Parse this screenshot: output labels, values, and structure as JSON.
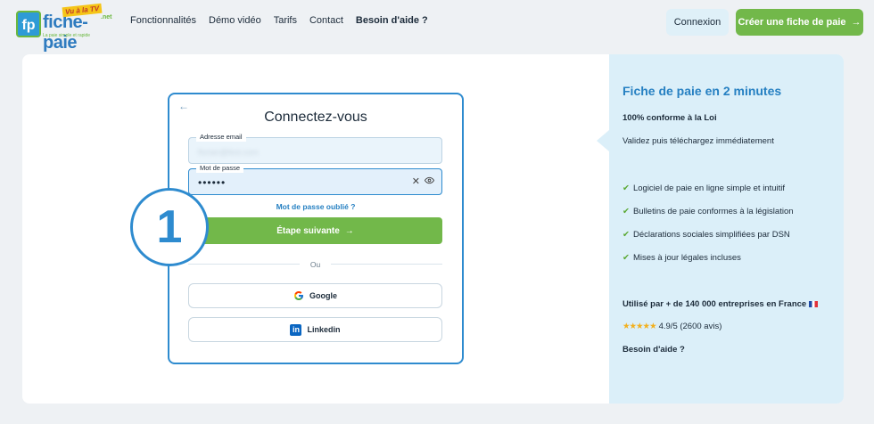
{
  "logo": {
    "mark": "fp",
    "word": "fiche-paie",
    "badge": "Vu à la TV",
    "suffix": ".net",
    "tagline": "La paie simple et rapide"
  },
  "nav": {
    "items": [
      {
        "label": "Fonctionnalités"
      },
      {
        "label": "Démo vidéo"
      },
      {
        "label": "Tarifs"
      },
      {
        "label": "Contact"
      },
      {
        "label": "Besoin d'aide ?"
      }
    ]
  },
  "header": {
    "login_label": "Connexion",
    "create_label": "Créer une fiche de paie",
    "create_arrow": "→"
  },
  "login": {
    "back_arrow": "←",
    "title": "Connectez-vous",
    "email": {
      "label": "Adresse email",
      "value": "florian@fest.com"
    },
    "password": {
      "label": "Mot de passe",
      "value": "••••••",
      "clear_icon": "✕",
      "eye_icon": "👁"
    },
    "forgot": "Mot de passe oublié ?",
    "next_label": "Étape suivante",
    "next_arrow": "→",
    "divider": "Ou",
    "google_label": "Google",
    "linkedin_label": "Linkedin",
    "linkedin_glyph": "in"
  },
  "step": {
    "number": "1"
  },
  "side": {
    "title": "Fiche de paie en 2 minutes",
    "compliance": "100% conforme à la Loi",
    "validate": "Validez puis téléchargez immédiatement",
    "check": "✔",
    "features": [
      "Logiciel de paie en ligne simple et intuitif",
      "Bulletins de paie conformes à la législation",
      "Déclarations sociales simplifiées par DSN",
      "Mises à jour légales incluses"
    ],
    "used_by": "Utilisé par + de 140 000 entreprises en France",
    "stars": "★★★★★",
    "rating": "4.9/5 (2600 avis)",
    "help": "Besoin d'aide ?"
  },
  "colors": {
    "primary": "#2e8bcf",
    "accent_green": "#72b84a",
    "side_bg": "#dbeff9"
  }
}
